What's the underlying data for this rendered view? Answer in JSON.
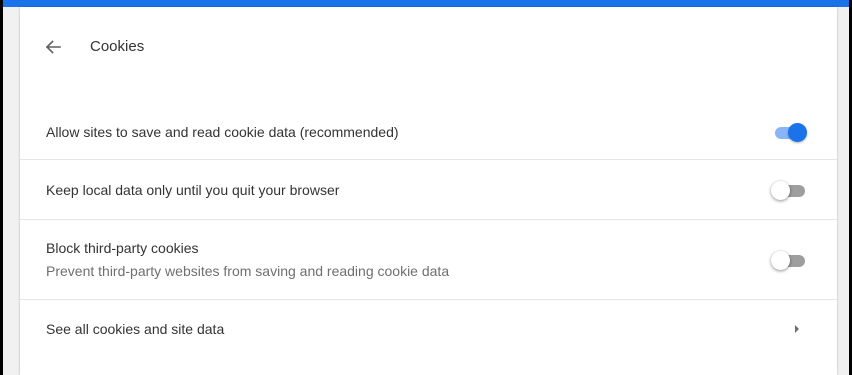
{
  "header": {
    "title": "Cookies",
    "back_icon": "arrow-left-icon"
  },
  "settings": {
    "allow_sites": {
      "label": "Allow sites to save and read cookie data (recommended)",
      "enabled": true
    },
    "keep_local": {
      "label": "Keep local data only until you quit your browser",
      "enabled": false
    },
    "block_third_party": {
      "label": "Block third-party cookies",
      "sublabel": "Prevent third-party websites from saving and reading cookie data",
      "enabled": false
    },
    "see_all": {
      "label": "See all cookies and site data",
      "icon": "chevron-right-icon"
    }
  },
  "colors": {
    "accent": "#1a73e8",
    "accent_track": "#8ab4f8",
    "top_bar": "#1a73e8"
  }
}
